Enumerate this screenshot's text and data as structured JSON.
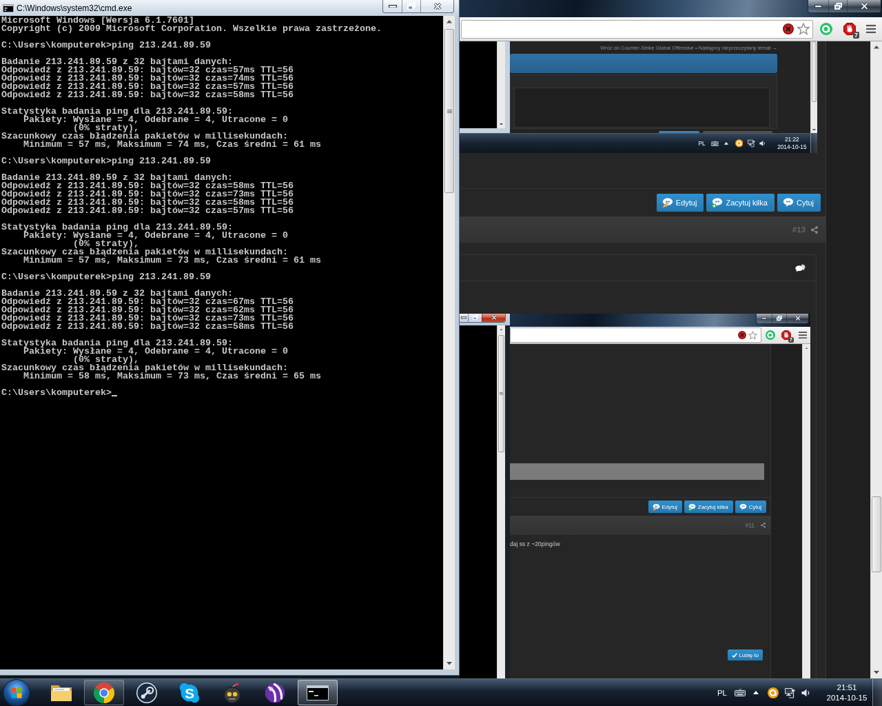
{
  "cmd_window": {
    "title": "C:\\Windows\\system32\\cmd.exe",
    "blocks": [
      {
        "lines": [
          "Microsoft Windows [Wersja 6.1.7601]",
          "Copyright (c) 2009 Microsoft Corporation. Wszelkie prawa zastrzeżone."
        ]
      },
      {
        "lines": [
          "C:\\Users\\komputerek>ping 213.241.89.59"
        ]
      },
      {
        "lines": [
          "Badanie 213.241.89.59 z 32 bajtami danych:",
          "Odpowiedź z 213.241.89.59: bajtów=32 czas=57ms TTL=56",
          "Odpowiedź z 213.241.89.59: bajtów=32 czas=74ms TTL=56",
          "Odpowiedź z 213.241.89.59: bajtów=32 czas=57ms TTL=56",
          "Odpowiedź z 213.241.89.59: bajtów=32 czas=58ms TTL=56"
        ]
      },
      {
        "lines": [
          "Statystyka badania ping dla 213.241.89.59:",
          "    Pakiety: Wysłane = 4, Odebrane = 4, Utracone = 0",
          "             (0% straty),",
          "Szacunkowy czas błądzenia pakietów w millisekundach:",
          "    Minimum = 57 ms, Maksimum = 74 ms, Czas średni = 61 ms"
        ]
      },
      {
        "lines": [
          "C:\\Users\\komputerek>ping 213.241.89.59"
        ]
      },
      {
        "lines": [
          "Badanie 213.241.89.59 z 32 bajtami danych:",
          "Odpowiedź z 213.241.89.59: bajtów=32 czas=58ms TTL=56",
          "Odpowiedź z 213.241.89.59: bajtów=32 czas=73ms TTL=56",
          "Odpowiedź z 213.241.89.59: bajtów=32 czas=58ms TTL=56",
          "Odpowiedź z 213.241.89.59: bajtów=32 czas=57ms TTL=56"
        ]
      },
      {
        "lines": [
          "Statystyka badania ping dla 213.241.89.59:",
          "    Pakiety: Wysłane = 4, Odebrane = 4, Utracone = 0",
          "             (0% straty),",
          "Szacunkowy czas błądzenia pakietów w millisekundach:",
          "    Minimum = 57 ms, Maksimum = 73 ms, Czas średni = 61 ms"
        ]
      },
      {
        "lines": [
          "C:\\Users\\komputerek>ping 213.241.89.59"
        ]
      },
      {
        "lines": [
          "Badanie 213.241.89.59 z 32 bajtami danych:",
          "Odpowiedź z 213.241.89.59: bajtów=32 czas=67ms TTL=56",
          "Odpowiedź z 213.241.89.59: bajtów=32 czas=62ms TTL=56",
          "Odpowiedź z 213.241.89.59: bajtów=32 czas=73ms TTL=56",
          "Odpowiedź z 213.241.89.59: bajtów=32 czas=58ms TTL=56"
        ]
      },
      {
        "lines": [
          "Statystyka badania ping dla 213.241.89.59:",
          "    Pakiety: Wysłane = 4, Odebrane = 4, Utracone = 0",
          "             (0% straty),",
          "Szacunkowy czas błądzenia pakietów w millisekundach:",
          "    Minimum = 58 ms, Maksimum = 73 ms, Czas średni = 65 ms"
        ]
      },
      {
        "lines": [
          "C:\\Users\\komputerek>"
        ]
      }
    ],
    "cursor": true
  },
  "browser": {
    "extension_badge": "7",
    "page": {
      "top_screenshot": {
        "breadcrumb": "Wróć do Counter-Strike Global Offensive • Następny nieprzeczytany temat →",
        "tray": {
          "language": "PL",
          "time": "21:22",
          "date": "2014-10-15"
        }
      },
      "post_actions": [
        {
          "kind": "edit",
          "label": "Edytuj"
        },
        {
          "kind": "multiquote",
          "label": "Zacytuj kilka"
        },
        {
          "kind": "quote",
          "label": "Cytuj"
        }
      ],
      "post_number": "#13",
      "bottom_screenshot": {
        "cmd_window": {
          "active": true
        },
        "extension_badge": "7",
        "post_actions": [
          {
            "kind": "edit",
            "label": "Edytuj"
          },
          {
            "kind": "multiquote",
            "label": "Zacytuj kilka"
          },
          {
            "kind": "quote",
            "label": "Cytuj"
          }
        ],
        "post_number": "#11",
        "post_text": "daj ss z ~20pingów",
        "like_button": "Lubię to"
      }
    }
  },
  "taskbar": {
    "apps": [
      {
        "kind": "folder",
        "running": false,
        "selected": false
      },
      {
        "kind": "browser",
        "running": true,
        "selected": false
      },
      {
        "kind": "piston",
        "running": false,
        "selected": false
      },
      {
        "kind": "messenger",
        "glyph": "S",
        "running": false,
        "selected": false
      },
      {
        "kind": "robot",
        "running": false,
        "selected": false
      },
      {
        "kind": "ball",
        "running": false,
        "selected": false
      },
      {
        "kind": "terminal",
        "running": true,
        "selected": true
      }
    ],
    "tray": {
      "language": "PL",
      "time": "21:51",
      "date": "2014-10-15"
    }
  }
}
